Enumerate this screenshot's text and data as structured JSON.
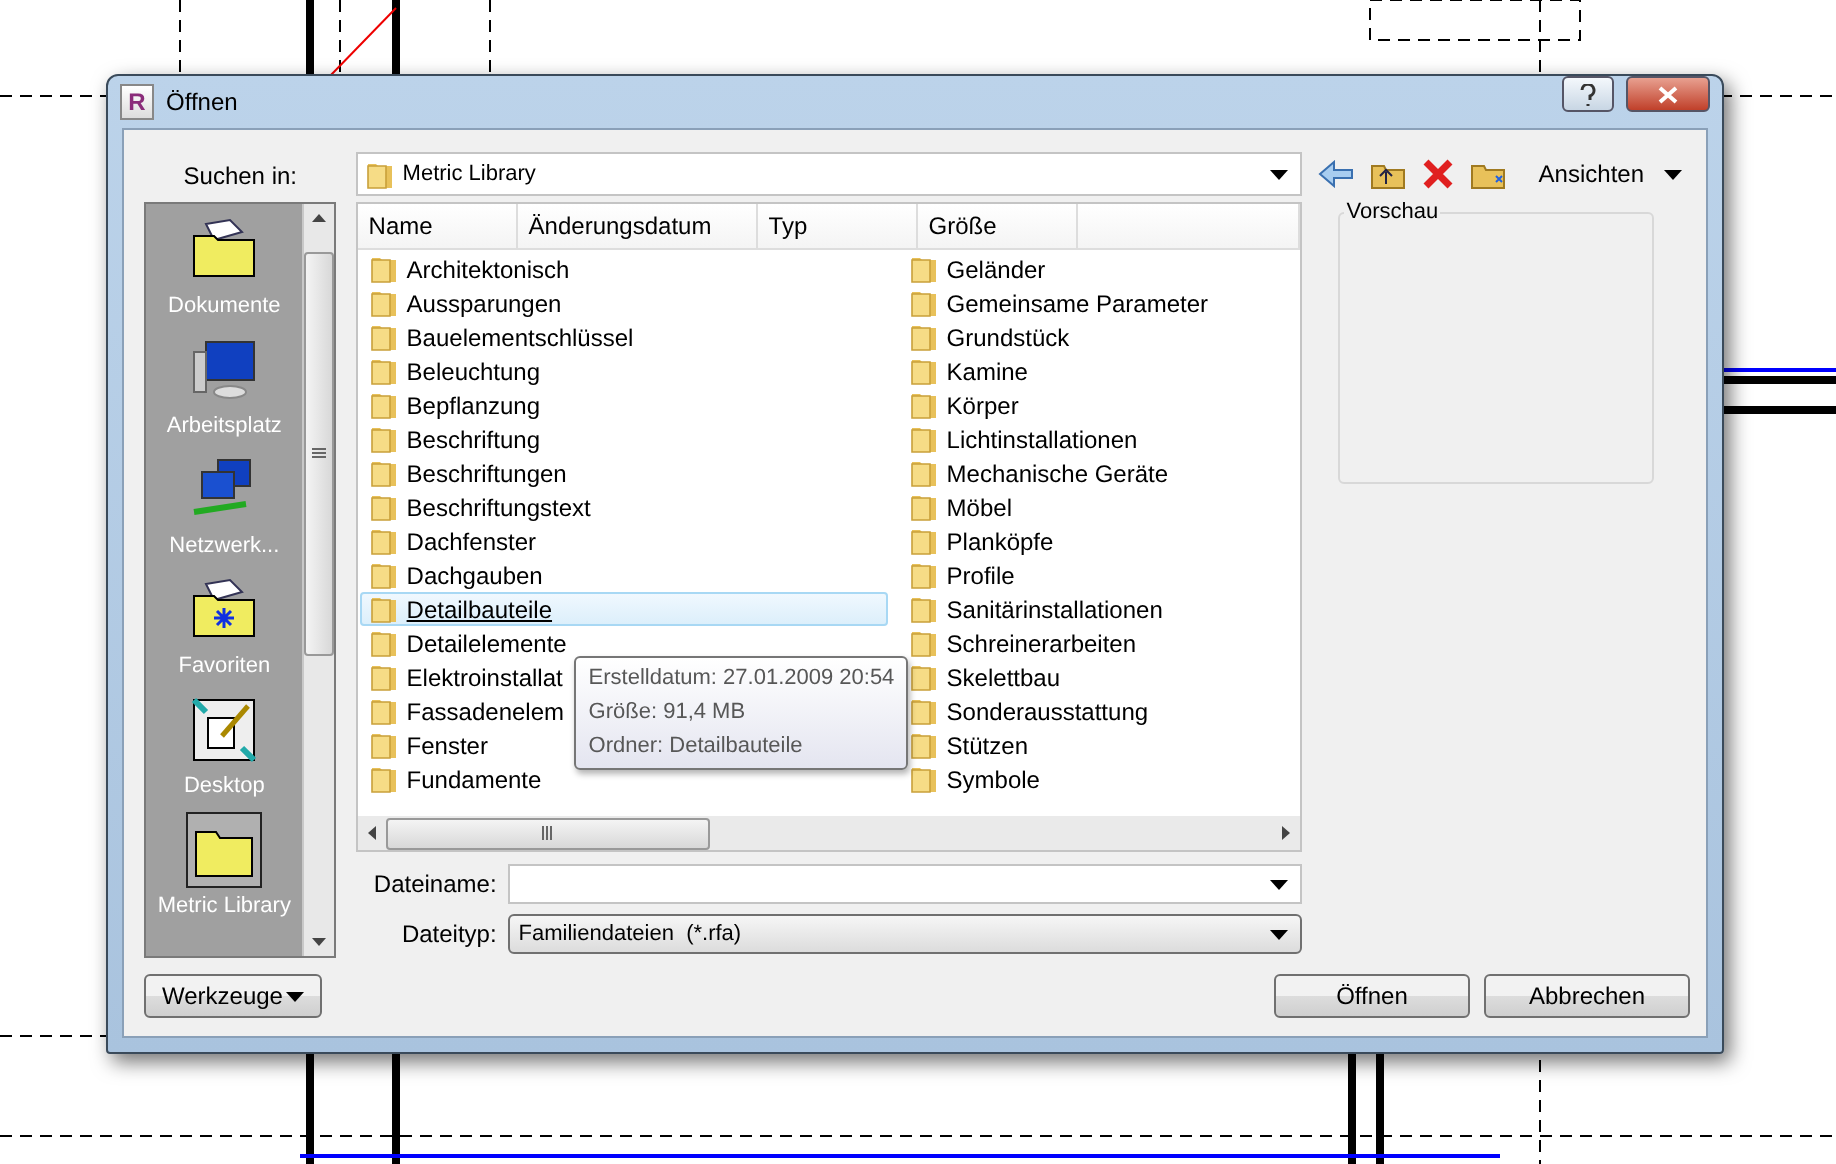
{
  "window": {
    "title": "Öffnen",
    "icon_letter": "R"
  },
  "look_in": {
    "label": "Suchen in:",
    "value": "Metric Library"
  },
  "toolbar": {
    "views_label": "Ansichten"
  },
  "places": [
    {
      "kind": "documents",
      "label": "Dokumente",
      "selected": false
    },
    {
      "kind": "computer",
      "label": "Arbeitsplatz",
      "selected": false
    },
    {
      "kind": "network",
      "label": "Netzwerk...",
      "selected": false
    },
    {
      "kind": "favorites",
      "label": "Favoriten",
      "selected": false
    },
    {
      "kind": "desktop",
      "label": "Desktop",
      "selected": false
    },
    {
      "kind": "folder",
      "label": "Metric Library",
      "selected": true
    }
  ],
  "columns": [
    "Name",
    "Änderungsdatum",
    "Typ",
    "Größe"
  ],
  "files": [
    {
      "name": "Architektonisch",
      "selected": false
    },
    {
      "name": "Aussparungen",
      "selected": false
    },
    {
      "name": "Bauelementschlüssel",
      "selected": false
    },
    {
      "name": "Beleuchtung",
      "selected": false
    },
    {
      "name": "Bepflanzung",
      "selected": false
    },
    {
      "name": "Beschriftung",
      "selected": false
    },
    {
      "name": "Beschriftungen",
      "selected": false
    },
    {
      "name": "Beschriftungstext",
      "selected": false
    },
    {
      "name": "Dachfenster",
      "selected": false
    },
    {
      "name": "Dachgauben",
      "selected": false
    },
    {
      "name": "Detailbauteile",
      "selected": true
    },
    {
      "name": "Detailelemente",
      "selected": false
    },
    {
      "name": "Elektroinstallat",
      "selected": false
    },
    {
      "name": "Fassadenelem",
      "selected": false
    },
    {
      "name": "Fenster",
      "selected": false
    },
    {
      "name": "Fundamente",
      "selected": false
    },
    {
      "name": "Geländer",
      "selected": false
    },
    {
      "name": "Gemeinsame Parameter",
      "selected": false
    },
    {
      "name": "Grundstück",
      "selected": false
    },
    {
      "name": "Kamine",
      "selected": false
    },
    {
      "name": "Körper",
      "selected": false
    },
    {
      "name": "Lichtinstallationen",
      "selected": false
    },
    {
      "name": "Mechanische Geräte",
      "selected": false
    },
    {
      "name": "Möbel",
      "selected": false
    },
    {
      "name": "Planköpfe",
      "selected": false
    },
    {
      "name": "Profile",
      "selected": false
    },
    {
      "name": "Sanitärinstallationen",
      "selected": false
    },
    {
      "name": "Schreinerarbeiten",
      "selected": false
    },
    {
      "name": "Skelettbau",
      "selected": false
    },
    {
      "name": "Sonderausstattung",
      "selected": false
    },
    {
      "name": "Stützen",
      "selected": false
    },
    {
      "name": "Symbole",
      "selected": false
    }
  ],
  "tooltip": {
    "lines": [
      "Erstelldatum: 27.01.2009 20:54",
      "Größe: 91,4 MB",
      "Ordner: Detailbauteile"
    ]
  },
  "preview": {
    "label": "Vorschau"
  },
  "file_name": {
    "label": "Dateiname:"
  },
  "file_type": {
    "label": "Dateityp:",
    "value": "Familiendateien  (*.rfa)"
  },
  "buttons": {
    "tools": "Werkzeuge",
    "open": "Öffnen",
    "cancel": "Abbrechen"
  }
}
